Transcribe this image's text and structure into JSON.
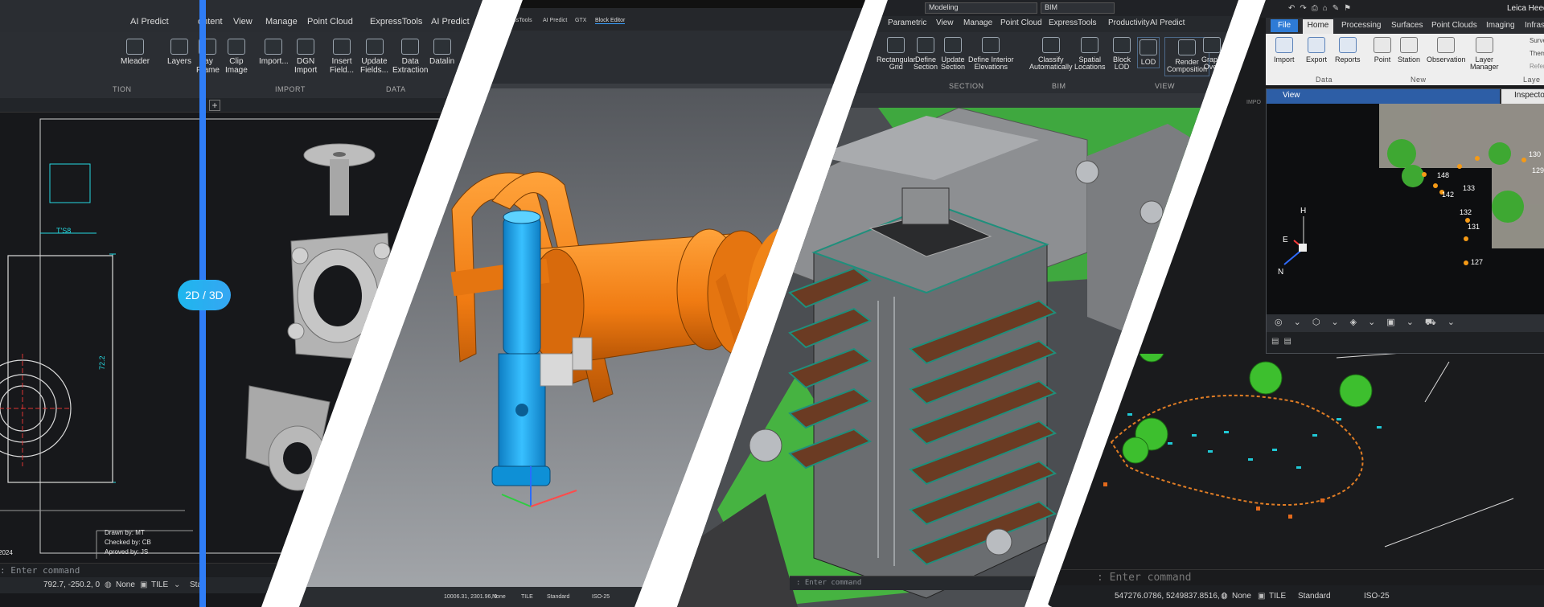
{
  "toggle_label": "2D / 3D",
  "panel1": {
    "tabs": [
      "AI Predict",
      "ontent",
      "View",
      "Manage",
      "Point Cloud",
      "ExpressTools",
      "AI Predict"
    ],
    "tools": [
      "Mleader",
      "Layers",
      "lay\nFrame",
      "Clip\nImage",
      "Import...",
      "DGN\nImport",
      "Insert\nField...",
      "Update\nFields...",
      "Data\nExtraction",
      "Datalin"
    ],
    "groups": [
      "TION",
      "IMPORT",
      "DATA"
    ],
    "dimension_left": "T'S8",
    "dimension_vertical": "72.2",
    "title_block": [
      "Drawn by: MT",
      "Checked by: CB",
      "Aproved by: JS"
    ],
    "year": "2024",
    "command_prompt": ": Enter command",
    "coords": "792.7, -250.2, 0",
    "status_none": "None",
    "status_tile": "TILE",
    "status_st": "Sta"
  },
  "panel2": {
    "tabs": [
      "ressTools",
      "AI Predict",
      "GTX",
      "Block Editor"
    ],
    "coords": "10006.31, 2301.96, 0",
    "status_none": "None",
    "status_tile": "TILE",
    "status_standard": "Standard",
    "status_iso": "ISO-25"
  },
  "panel3": {
    "workspace": "Modeling",
    "bim": "BIM",
    "tabs": [
      "Parametric",
      "View",
      "Manage",
      "Point Cloud",
      "ExpressTools",
      "Productivity",
      "AI Predict"
    ],
    "tools": [
      "Rectangular\nGrid",
      "Define\nSection",
      "Update\nSection",
      "Define Interior\nElevations",
      "Classify\nAutomatically",
      "Spatial\nLocations",
      "Block\nLOD",
      "LOD",
      "Render\nComposition",
      "Graph\nOver"
    ],
    "groups": [
      "SECTION",
      "BIM",
      "VIEW"
    ],
    "command_prompt": ": Enter command"
  },
  "panel4": {
    "app": "Leica Heed",
    "tabs": [
      "File",
      "Home",
      "Processing",
      "Surfaces",
      "Point Clouds",
      "Imaging",
      "Infrastr"
    ],
    "tools": [
      "Import",
      "Export",
      "Reports",
      "Point",
      "Station",
      "Observation",
      "Layer\nManager"
    ],
    "side": [
      "Surve",
      "Them",
      "Refer"
    ],
    "groups": [
      "Data",
      "New",
      "Laye"
    ],
    "view_tab": "View",
    "inspector_tab": "Inspector",
    "axis_h": "H",
    "axis_e": "E",
    "axis_n": "N",
    "point_labels": [
      "148",
      "142",
      "133",
      "132",
      "131",
      "127",
      "130",
      "129"
    ],
    "command_prompt": ": Enter command",
    "coords": "547276.0786, 5249837.8516, 0",
    "status_none": "None",
    "status_tile": "TILE",
    "status_standard": "Standard",
    "status_iso": "ISO-25",
    "import_side": "IMPO"
  },
  "colors": {
    "accent": "#2f7df6",
    "orange": "#f07b12",
    "teal": "#20c9d6",
    "blue_pipe": "#1aa0df"
  }
}
